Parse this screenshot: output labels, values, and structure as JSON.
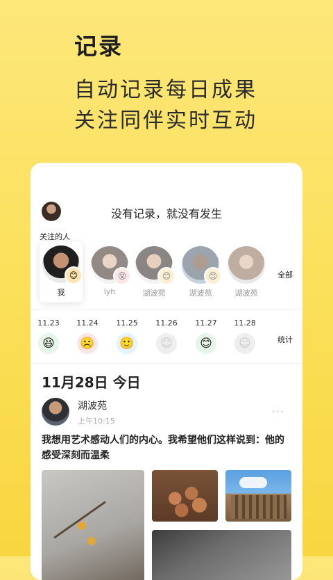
{
  "promo": {
    "title": "记录",
    "line1": "自动记录每日成果",
    "line2": "关注同伴实时互动"
  },
  "card": {
    "header_title": "没有记录，就没有发生",
    "following_label": "关注的人",
    "all_label": "全部",
    "stats_label": "统计",
    "friends": [
      {
        "name": "我",
        "mood_icon": "smile-icon",
        "mood_glyph": "😊"
      },
      {
        "name": "lyh",
        "mood_icon": "dizzy-face-icon",
        "mood_glyph": "😵"
      },
      {
        "name": "湖波苑",
        "mood_icon": "smile-icon",
        "mood_glyph": "😊"
      },
      {
        "name": "湖波苑",
        "mood_icon": "smile-icon",
        "mood_glyph": "😊"
      },
      {
        "name": "湖波苑",
        "mood_icon": "smile-icon",
        "mood_glyph": "😊"
      }
    ],
    "days": [
      {
        "date": "11.23",
        "mood_icon": "laughing-face-icon",
        "glyph": "😆"
      },
      {
        "date": "11.24",
        "mood_icon": "frown-face-icon",
        "glyph": "☹️"
      },
      {
        "date": "11.25",
        "mood_icon": "slight-smile-icon",
        "glyph": "🙂"
      },
      {
        "date": "11.26",
        "mood_icon": "add-mood-icon",
        "glyph": "☺"
      },
      {
        "date": "11.27",
        "mood_icon": "smile-icon",
        "glyph": "😊"
      },
      {
        "date": "11.28",
        "mood_icon": "add-mood-icon",
        "glyph": "☺"
      }
    ],
    "feed": {
      "date_heading": "11月28日 今日",
      "post": {
        "author": "湖波苑",
        "time": "上午10:15",
        "more": "···",
        "text": "我想用艺术感动人们的内心。我希望他们这样说到：他的感受深刻而温柔"
      }
    }
  }
}
